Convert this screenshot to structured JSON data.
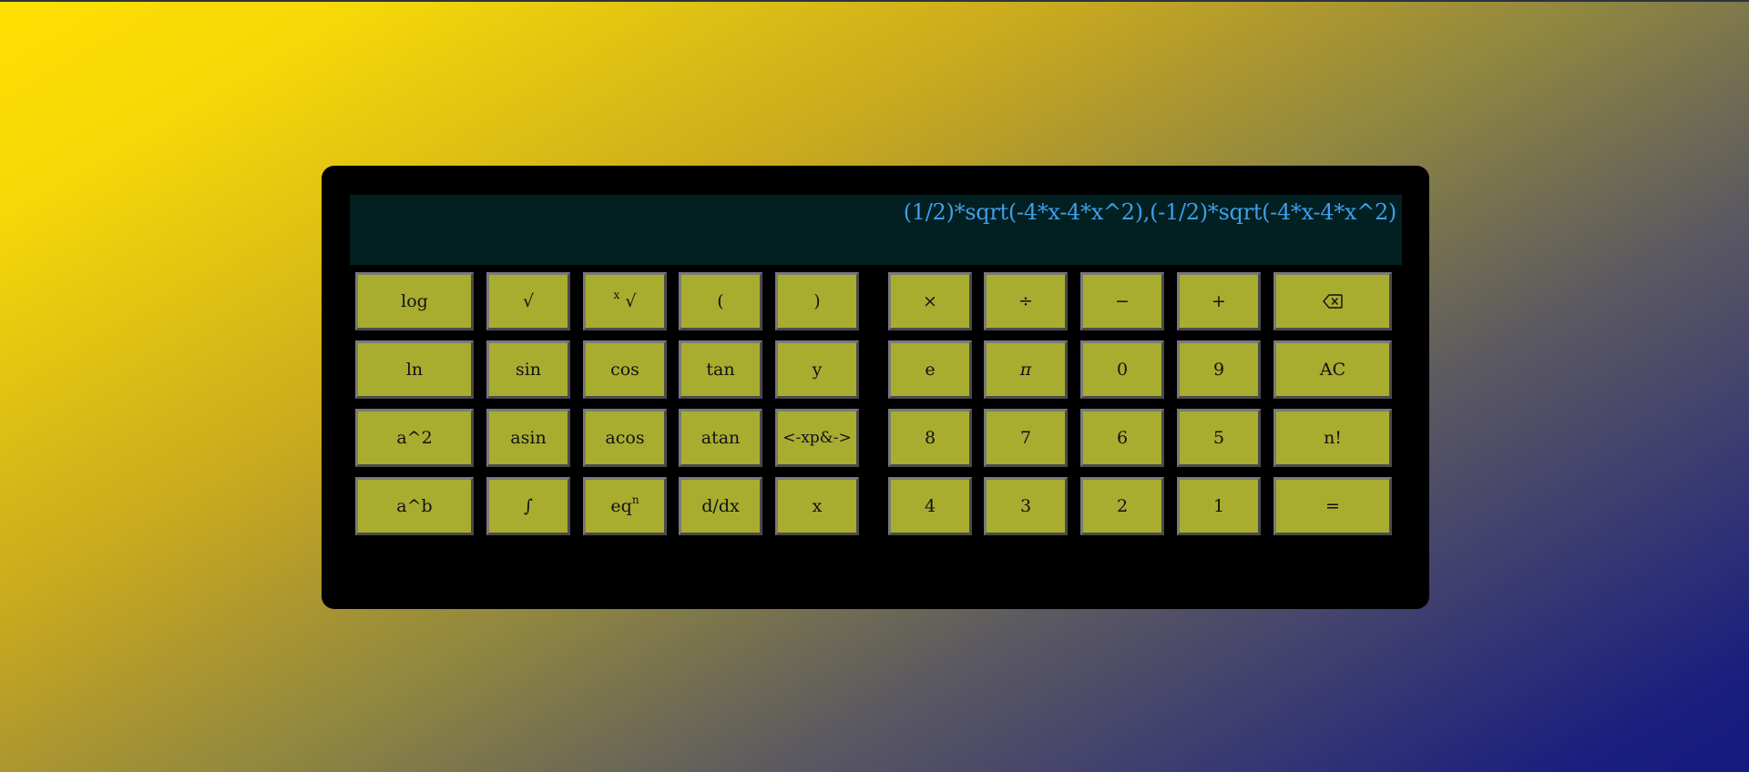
{
  "display": {
    "expression": "(1/2)*sqrt(-4*x-4*x^2),(-1/2)*sqrt(-4*x-4*x^2)"
  },
  "keys": {
    "log": "log",
    "sqrt": "√",
    "xroot_x": "x",
    "xroot_sym": "√",
    "lparen": "(",
    "rparen": ")",
    "multiply": "×",
    "divide": "÷",
    "minus": "−",
    "plus": "+",
    "backspace": "backspace-icon",
    "ln": "ln",
    "sin": "sin",
    "cos": "cos",
    "tan": "tan",
    "y": "y",
    "e": "e",
    "pi": "π",
    "d0": "0",
    "d9": "9",
    "ac": "AC",
    "square": "a^2",
    "asin": "asin",
    "acos": "acos",
    "atan": "atan",
    "exp": "<-xp&->",
    "d8": "8",
    "d7": "7",
    "d6": "6",
    "d5": "5",
    "factorial": "n!",
    "power": "a^b",
    "integral": "∫",
    "eqn_base": "eq",
    "eqn_sup": "n",
    "derivative": "d/dx",
    "x": "x",
    "d4": "4",
    "d3": "3",
    "d2": "2",
    "d1": "1",
    "equals": "="
  }
}
